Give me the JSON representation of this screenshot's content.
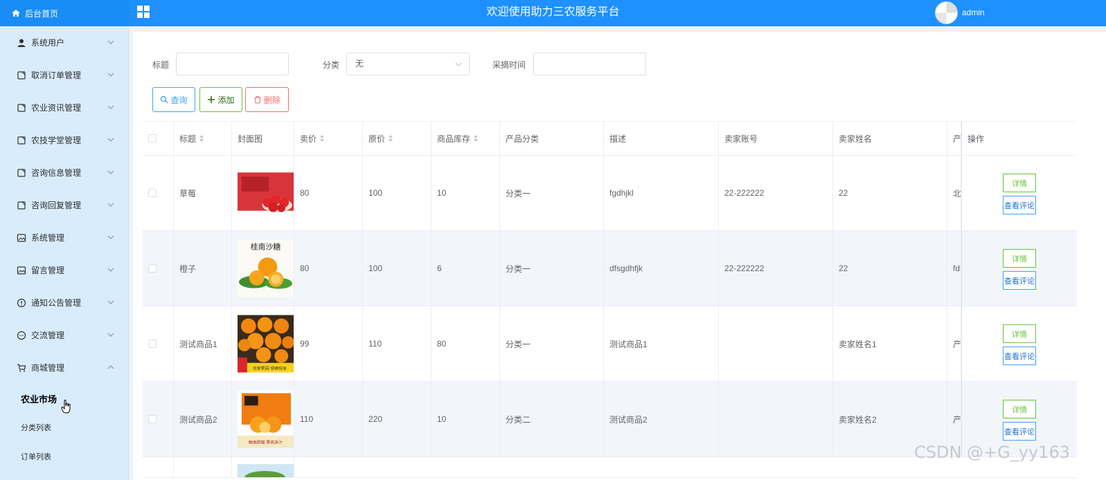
{
  "header": {
    "home_label": "后台首页",
    "title": "欢迎使用助力三农服务平台",
    "username": "admin"
  },
  "sidebar": {
    "items": [
      {
        "label": "系统用户",
        "icon": "user-icon"
      },
      {
        "label": "取消订单管理",
        "icon": "document-icon"
      },
      {
        "label": "农业资讯管理",
        "icon": "document-icon"
      },
      {
        "label": "农技学堂管理",
        "icon": "document-icon"
      },
      {
        "label": "咨询信息管理",
        "icon": "document-icon"
      },
      {
        "label": "咨询回复管理",
        "icon": "document-icon"
      },
      {
        "label": "系统管理",
        "icon": "picture-icon"
      },
      {
        "label": "留言管理",
        "icon": "picture-icon"
      },
      {
        "label": "通知公告管理",
        "icon": "info-icon"
      },
      {
        "label": "交流管理",
        "icon": "chat-icon"
      },
      {
        "label": "商城管理",
        "icon": "cart-icon"
      }
    ],
    "subitems": [
      {
        "label": "农业市场",
        "active": true
      },
      {
        "label": "分类列表",
        "active": false
      },
      {
        "label": "订单列表",
        "active": false
      }
    ]
  },
  "search": {
    "title_label": "标题",
    "title_value": "",
    "category_label": "分类",
    "category_value": "无",
    "pick_time_label": "采摘时间",
    "pick_time_value": ""
  },
  "toolbar": {
    "query_label": "查询",
    "add_label": "添加",
    "delete_label": "删除"
  },
  "table": {
    "columns": [
      "标题",
      "封面图",
      "卖价",
      "原价",
      "商品库存",
      "产品分类",
      "描述",
      "卖家账号",
      "卖家姓名",
      "产",
      "操作"
    ],
    "rows": [
      {
        "title": "草莓",
        "sell": "80",
        "orig": "100",
        "stock": "10",
        "cat": "分类一",
        "desc": "fgdhjkl",
        "account": "22-222222",
        "seller": "22",
        "prod": "北",
        "thumb": "strawberry"
      },
      {
        "title": "橙子",
        "sell": "80",
        "orig": "100",
        "stock": "6",
        "cat": "分类一",
        "desc": "dfsgdhfjk",
        "account": "22-222222",
        "seller": "22",
        "prod": "fds",
        "thumb": "orange"
      },
      {
        "title": "测试商品1",
        "sell": "99",
        "orig": "110",
        "stock": "80",
        "cat": "分类一",
        "desc": "测试商品1",
        "account": "",
        "seller": "卖家姓名1",
        "prod": "产",
        "thumb": "oranges"
      },
      {
        "title": "测试商品2",
        "sell": "110",
        "orig": "220",
        "stock": "10",
        "cat": "分类二",
        "desc": "测试商品2",
        "account": "",
        "seller": "卖家姓名2",
        "prod": "产",
        "thumb": "orangebox"
      }
    ],
    "detail_label": "详情",
    "review_label": "查看评论"
  },
  "thumb_text": {
    "orange_caption": "桂南沙糖",
    "oranges_caption": "农家果园 现摘现发",
    "orangebox_caption": "赣南脐橙 果肉多汁"
  },
  "watermark": "CSDN @+G_yy163",
  "colors": {
    "topbar": "#1e90ff",
    "sidebar": "#d9ecfb",
    "primary": "#409eff",
    "success": "#67c23a",
    "danger": "#f56c6c"
  }
}
